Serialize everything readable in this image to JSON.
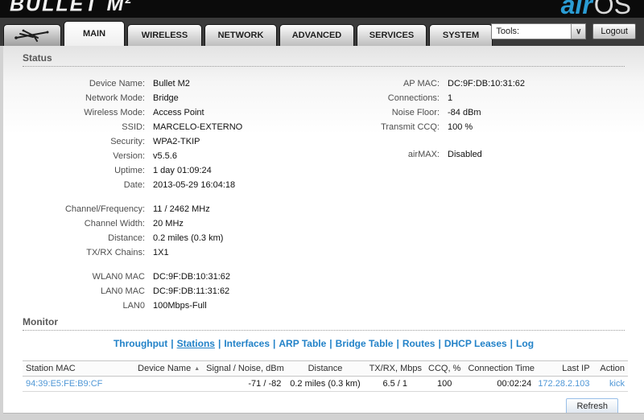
{
  "header": {
    "brand": {
      "name": "BULLET",
      "model": "M",
      "model_sup": "2"
    },
    "airos": {
      "air": "air",
      "os": "OS"
    },
    "tabs": [
      "MAIN",
      "WIRELESS",
      "NETWORK",
      "ADVANCED",
      "SERVICES",
      "SYSTEM"
    ],
    "active_tab": "MAIN",
    "tools": {
      "label": "Tools:"
    },
    "logout_label": "Logout"
  },
  "status": {
    "title": "Status",
    "left_g1": [
      {
        "label": "Device Name:",
        "value": "Bullet M2"
      },
      {
        "label": "Network Mode:",
        "value": "Bridge"
      },
      {
        "label": "Wireless Mode:",
        "value": "Access Point"
      },
      {
        "label": "SSID:",
        "value": "MARCELO-EXTERNO"
      },
      {
        "label": "Security:",
        "value": "WPA2-TKIP"
      },
      {
        "label": "Version:",
        "value": "v5.5.6"
      },
      {
        "label": "Uptime:",
        "value": "1 day 01:09:24"
      },
      {
        "label": "Date:",
        "value": "2013-05-29 16:04:18"
      }
    ],
    "left_g2": [
      {
        "label": "Channel/Frequency:",
        "value": "11 / 2462 MHz"
      },
      {
        "label": "Channel Width:",
        "value": "20 MHz"
      },
      {
        "label": "Distance:",
        "value": "0.2 miles (0.3 km)"
      },
      {
        "label": "TX/RX Chains:",
        "value": "1X1"
      }
    ],
    "left_g3": [
      {
        "label": "WLAN0 MAC",
        "value": "DC:9F:DB:10:31:62"
      },
      {
        "label": "LAN0 MAC",
        "value": "DC:9F:DB:11:31:62"
      },
      {
        "label": "LAN0",
        "value": "100Mbps-Full"
      }
    ],
    "right_g1": [
      {
        "label": "AP MAC:",
        "value": "DC:9F:DB:10:31:62"
      },
      {
        "label": "Connections:",
        "value": "1"
      },
      {
        "label": "Noise Floor:",
        "value": "-84 dBm"
      },
      {
        "label": "Transmit CCQ:",
        "value": "100 %"
      }
    ],
    "right_g2": [
      {
        "label": "airMAX:",
        "value": "Disabled"
      }
    ]
  },
  "monitor": {
    "title": "Monitor",
    "separator": "|",
    "links": [
      "Throughput",
      "Stations",
      "Interfaces",
      "ARP Table",
      "Bridge Table",
      "Routes",
      "DHCP Leases",
      "Log"
    ],
    "active_link": "Stations",
    "table": {
      "headers": [
        "Station MAC",
        "Device Name",
        "Signal / Noise, dBm",
        "Distance",
        "TX/RX, Mbps",
        "CCQ, %",
        "Connection Time",
        "Last IP",
        "Action"
      ],
      "sort_icon": "▲",
      "row": {
        "station_mac": "94:39:E5:FE:B9:CF",
        "device_name": "",
        "signal_noise": "-71 / -82",
        "distance": "0.2 miles (0.3 km)",
        "txrx": "6.5 / 1",
        "ccq": "100",
        "connection_time": "00:02:24",
        "last_ip": "172.28.2.103",
        "action": "kick"
      }
    },
    "refresh_label": "Refresh"
  },
  "colors": {
    "header_bg": "#0b0b0b",
    "tabbar_bg": "#3a3a3a",
    "air_blue": "#2a9cd4",
    "monitor_link_blue": "#2282c8",
    "table_link_blue": "#4f97d6",
    "refresh_border_blue": "#99bfe8"
  }
}
